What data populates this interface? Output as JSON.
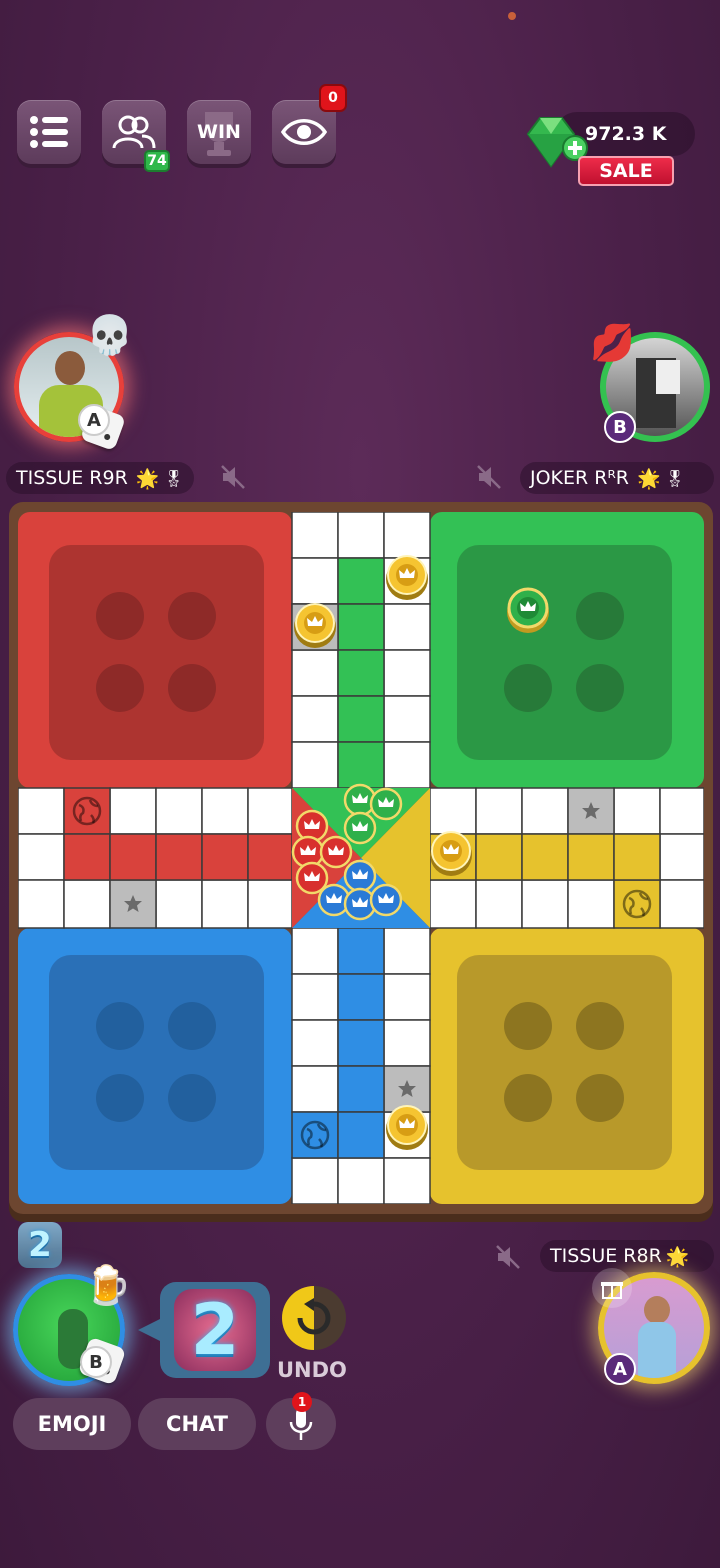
{
  "top_bar": {
    "friends_count": "74",
    "win_label": "WIN",
    "spectator_count": "0",
    "gems": "972.3 K",
    "sale_label": "SALE"
  },
  "players": {
    "top_left": {
      "name": "TISSUE R9R",
      "seat": "A",
      "color": "red"
    },
    "top_right": {
      "name": "JOKER RᴿR",
      "seat": "B",
      "color": "green"
    },
    "bottom_left": {
      "seat": "B",
      "color": "blue",
      "dice_value": "2",
      "badge_value": "2"
    },
    "bottom_right": {
      "name": "TISSUE R8R",
      "seat": "A",
      "color": "yellow"
    }
  },
  "controls": {
    "undo_label": "UNDO",
    "emoji_label": "EMOJI",
    "chat_label": "CHAT",
    "mic_notification": "1"
  },
  "colors": {
    "red": "#d9423c",
    "green": "#33c155",
    "blue": "#2f8ee4",
    "yellow": "#e6c22d",
    "background": "#4a2048"
  },
  "icons": [
    "menu-icon",
    "friends-icon",
    "trophy-icon",
    "eye-icon",
    "gem-icon",
    "skull-emoji-icon",
    "lips-emoji-icon",
    "dice-icon",
    "mute-icon",
    "star-icon",
    "globe-icon",
    "crown-icon",
    "undo-icon",
    "mic-icon",
    "beer-emoji-icon",
    "gift-icon"
  ]
}
